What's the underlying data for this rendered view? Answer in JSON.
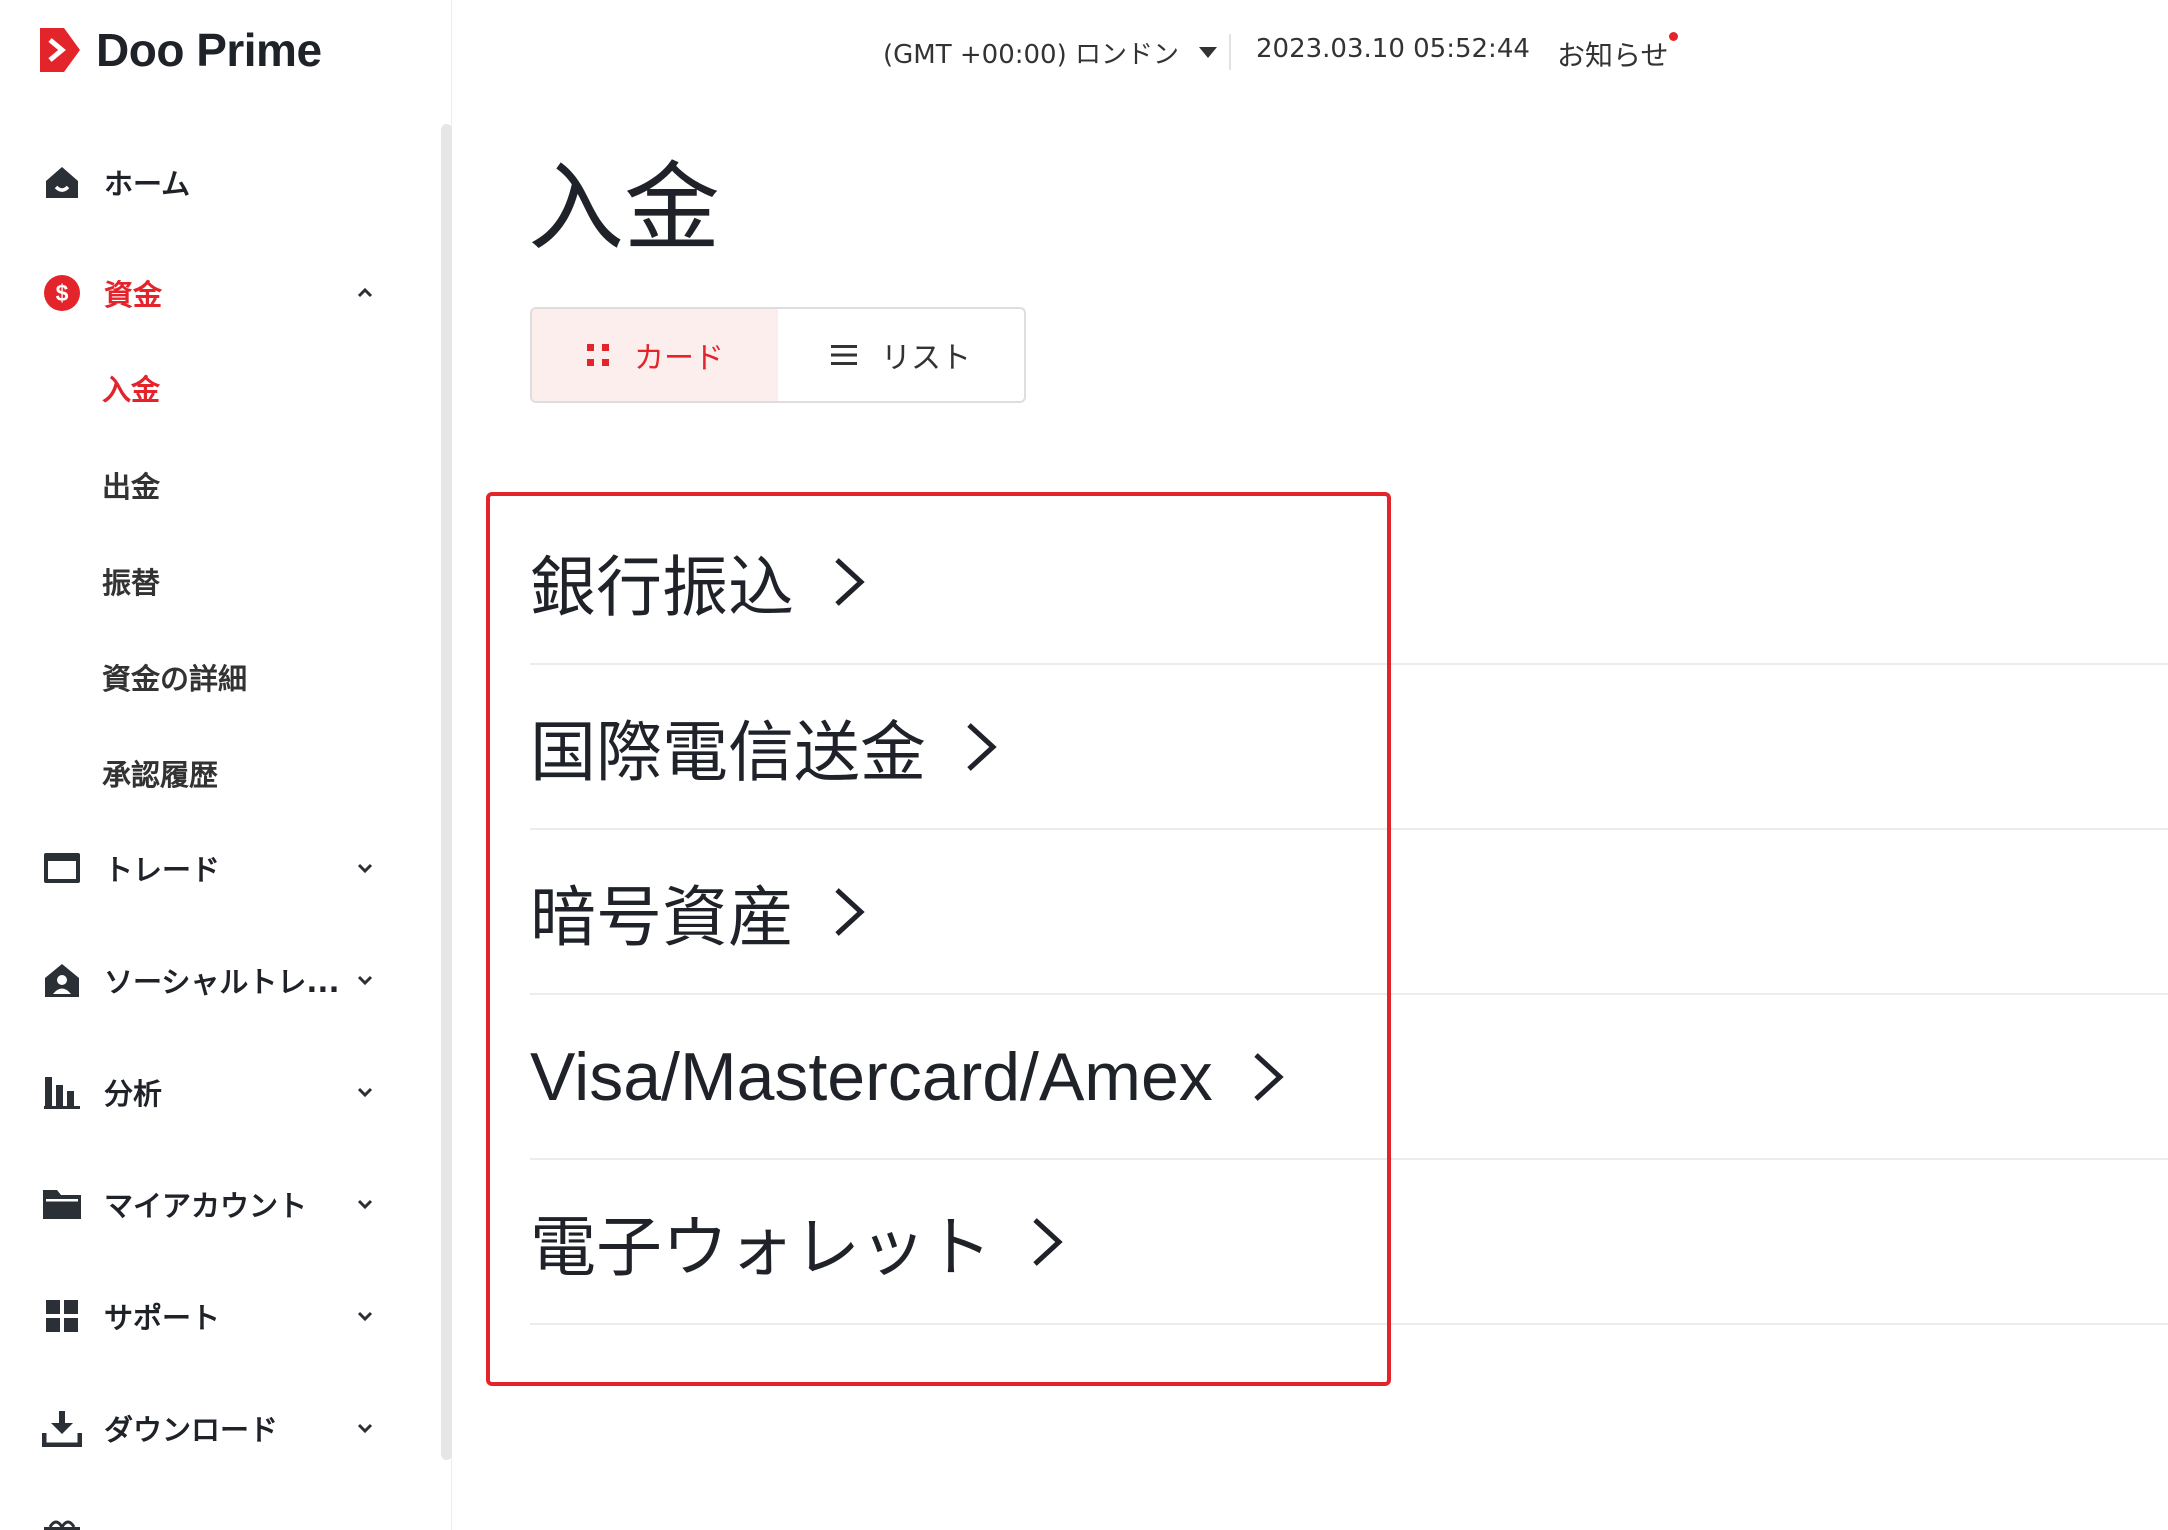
{
  "brand": {
    "name": "Doo Prime",
    "accent": "#e3242b"
  },
  "sidebar": {
    "items": [
      {
        "label": "ホーム",
        "icon": "home-icon"
      },
      {
        "label": "資金",
        "icon": "dollar-circle-icon",
        "expanded": true
      },
      {
        "label": "トレード",
        "icon": "trade-icon"
      },
      {
        "label": "ソーシャルトレ...",
        "icon": "social-trading-icon"
      },
      {
        "label": "分析",
        "icon": "bar-chart-icon"
      },
      {
        "label": "マイアカウント",
        "icon": "folder-icon"
      },
      {
        "label": "サポート",
        "icon": "grid-icon"
      },
      {
        "label": "ダウンロード",
        "icon": "download-icon"
      }
    ],
    "funds_sub": [
      {
        "label": "入金",
        "active": true
      },
      {
        "label": "出金"
      },
      {
        "label": "振替"
      },
      {
        "label": "資金の詳細"
      },
      {
        "label": "承認履歴"
      }
    ]
  },
  "header": {
    "timezone": "(GMT +00:00) ロンドン",
    "datetime": "2023.03.10 05:52:44",
    "notice": "お知らせ"
  },
  "main": {
    "title": "入金",
    "view_toggle": {
      "card": "カード",
      "list": "リスト",
      "selected": "card"
    },
    "methods": [
      "銀行振込",
      "国際電信送金",
      "暗号資産",
      "Visa/Mastercard/Amex",
      "電子ウォレット"
    ]
  }
}
